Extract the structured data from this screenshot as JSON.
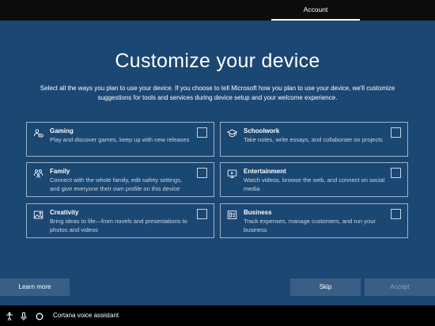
{
  "header": {
    "tab_account": "Account"
  },
  "main": {
    "title": "Customize your device",
    "subtitle": "Select all the ways you plan to use your device. If you choose to tell Microsoft how you plan to use your device, we'll customize suggestions for tools and services during device setup and your welcome experience."
  },
  "cards": [
    {
      "title": "Gaming",
      "desc": "Play and discover games, keep up with new releases",
      "icon": "gamepad-icon",
      "checked": false
    },
    {
      "title": "Schoolwork",
      "desc": "Take notes, write essays, and collaborate on projects",
      "icon": "graduation-cap-icon",
      "checked": false
    },
    {
      "title": "Family",
      "desc": "Connect with the whole family, edit safety settings, and give everyone their own profile on this device",
      "icon": "family-icon",
      "checked": false
    },
    {
      "title": "Entertainment",
      "desc": "Watch videos, browse the web, and connect on social media",
      "icon": "tv-icon",
      "checked": false
    },
    {
      "title": "Creativity",
      "desc": "Bring ideas to life—from novels and presentations to photos and videos",
      "icon": "picture-icon",
      "checked": false
    },
    {
      "title": "Business",
      "desc": "Track expenses, manage customers, and run your business",
      "icon": "briefcase-icon",
      "checked": false
    }
  ],
  "footer": {
    "learn_more": "Learn more",
    "skip": "Skip",
    "accept": "Accept"
  },
  "taskbar": {
    "cortana": "Cortana voice assistant"
  },
  "colors": {
    "background": "#1b4773",
    "card_border": "#9fb4c9",
    "button": "#3a5f86"
  }
}
